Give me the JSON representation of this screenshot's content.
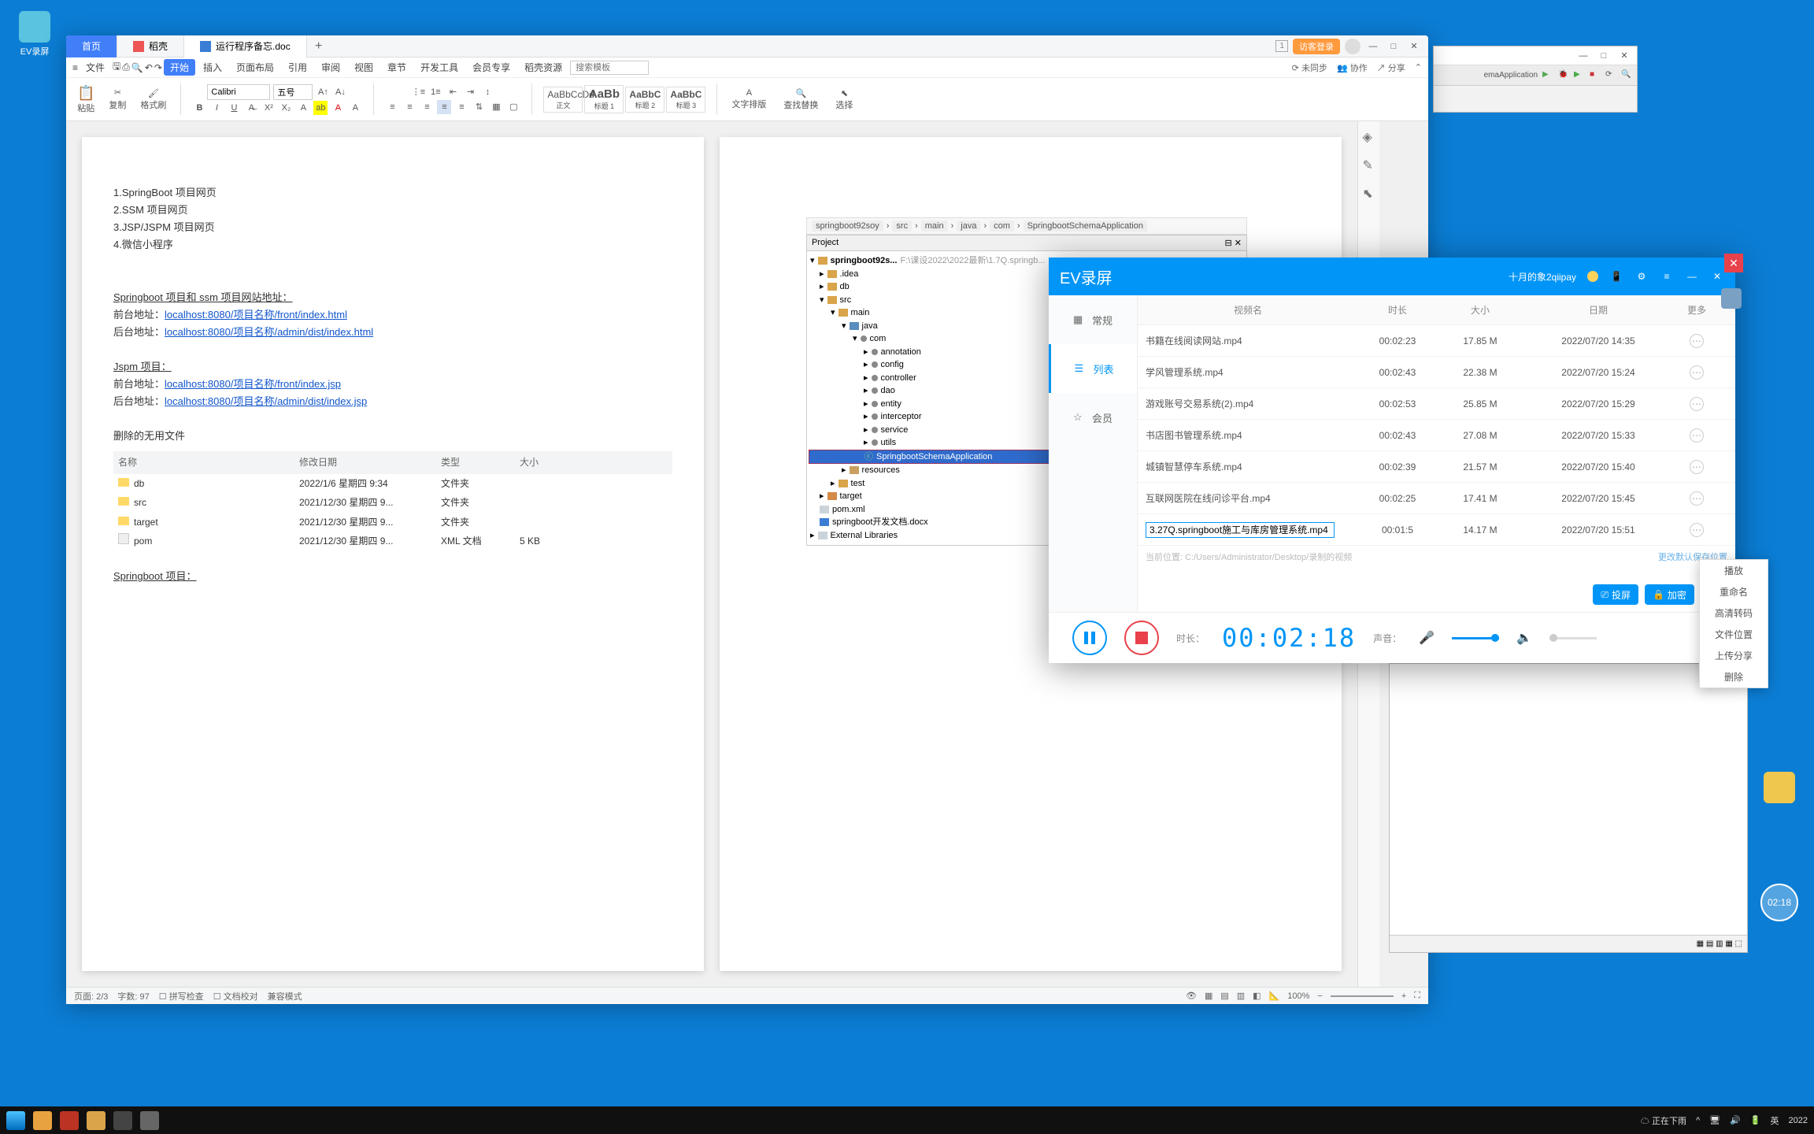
{
  "wps": {
    "tabs": {
      "home": "首页",
      "doc1": "稻壳",
      "doc2": "运行程序备忘.doc"
    },
    "visitor": "访客登录",
    "menubar": [
      "文件",
      "开始",
      "插入",
      "页面布局",
      "引用",
      "审阅",
      "视图",
      "章节",
      "开发工具",
      "会员专享",
      "稻壳资源"
    ],
    "menubar_search_placeholder": "搜索模板",
    "menubar_right": [
      "未同步",
      "协作",
      "分享"
    ],
    "ribbon": {
      "paste": "粘贴",
      "copy": "复制",
      "format_painter": "格式刷",
      "font_name": "Calibri",
      "font_size": "五号",
      "style_normal": "正文",
      "style_h1": "标题 1",
      "style_h2": "标题 2",
      "style_h3": "标题 3",
      "prev_normal": "AaBbCcDd",
      "prev_h": "AaBb",
      "prev_h2": "AaBbC",
      "prev_h3": "AaBbC",
      "text_tools": "文字排版",
      "find_replace": "查找替换",
      "select": "选择"
    },
    "doc": {
      "l1": "1.SpringBoot 项目网页",
      "l2": "2.SSM 项目网页",
      "l3": "3.JSP/JSPM 项目网页",
      "l4": "4.微信小程序",
      "sec2_title": "Springboot 项目和 ssm 项目网站地址：",
      "sec2_front_label": "前台地址：",
      "sec2_front_url": "localhost:8080/项目名称/front/index.html",
      "sec2_back_label": "后台地址：",
      "sec2_back_url": "localhost:8080/项目名称/admin/dist/index.html",
      "sec3_title": "Jspm 项目：",
      "sec3_front_url": "localhost:8080/项目名称/front/index.jsp",
      "sec3_back_url": "localhost:8080/项目名称/admin/dist/index.jsp",
      "sec4_title": "删除的无用文件",
      "table": {
        "h_name": "名称",
        "h_date": "修改日期",
        "h_type": "类型",
        "h_size": "大小",
        "rows": [
          {
            "name": "db",
            "date": "2022/1/6 星期四 9:34",
            "type": "文件夹",
            "size": ""
          },
          {
            "name": "src",
            "date": "2021/12/30 星期四 9...",
            "type": "文件夹",
            "size": ""
          },
          {
            "name": "target",
            "date": "2021/12/30 星期四 9...",
            "type": "文件夹",
            "size": ""
          },
          {
            "name": "pom",
            "date": "2021/12/30 星期四 9...",
            "type": "XML 文档",
            "size": "5 KB"
          }
        ]
      },
      "sec5_title": "Springboot 项目："
    },
    "ide_embed": {
      "crumbs": [
        "springboot92soy",
        "src",
        "main",
        "java",
        "com",
        "SpringbootSchemaApplication"
      ],
      "project_label": "Project",
      "root": "springboot92s...",
      "root_path": "F:\\课设2022\\2022最新\\1.7Q.springb...",
      "nodes": {
        "idea": ".idea",
        "db": "db",
        "src": "src",
        "main": "main",
        "java": "java",
        "com": "com",
        "annotation": "annotation",
        "config": "config",
        "controller": "controller",
        "dao": "dao",
        "entity": "entity",
        "interceptor": "interceptor",
        "service": "service",
        "utils": "utils",
        "app": "SpringbootSchemaApplication",
        "resources": "resources",
        "test": "test",
        "target": "target",
        "pom": "pom.xml",
        "devdoc": "springboot开发文档.docx",
        "extlib": "External Libraries"
      }
    },
    "statusbar": {
      "page": "页面: 2/3",
      "words": "字数: 97",
      "spell": "拼写检查",
      "proof": "文档校对",
      "compat": "兼容模式",
      "zoom": "100%"
    }
  },
  "ev": {
    "title": "EV录屏",
    "user": "十月的象2qiipay",
    "sidebar": {
      "general": "常规",
      "list": "列表",
      "member": "会员"
    },
    "columns": {
      "name": "视频名",
      "duration": "时长",
      "size": "大小",
      "date": "日期",
      "more": "更多"
    },
    "rows": [
      {
        "name": "书籍在线阅读网站.mp4",
        "duration": "00:02:23",
        "size": "17.85 M",
        "date": "2022/07/20 14:35"
      },
      {
        "name": "学风管理系统.mp4",
        "duration": "00:02:43",
        "size": "22.38 M",
        "date": "2022/07/20 15:24"
      },
      {
        "name": "游戏账号交易系统(2).mp4",
        "duration": "00:02:53",
        "size": "25.85 M",
        "date": "2022/07/20 15:29"
      },
      {
        "name": "书店图书管理系统.mp4",
        "duration": "00:02:43",
        "size": "27.08 M",
        "date": "2022/07/20 15:33"
      },
      {
        "name": "城镇智慧停车系统.mp4",
        "duration": "00:02:39",
        "size": "21.57 M",
        "date": "2022/07/20 15:40"
      },
      {
        "name": "互联网医院在线问诊平台.mp4",
        "duration": "00:02:25",
        "size": "17.41 M",
        "date": "2022/07/20 15:45"
      }
    ],
    "editing_row": {
      "value": "3.27Q.springboot施工与库房管理系统.mp4",
      "duration": "00:01:5",
      "size": "14.17 M",
      "date": "2022/07/20 15:51"
    },
    "path_label": "当前位置: C:/Users/Administrator/Desktop/录制的视频",
    "path_link": "更改默认保存位置",
    "bottom": {
      "duration_label": "时长：",
      "timer": "00:02:18",
      "sound_label": "声音："
    },
    "actions": {
      "record": "投屏",
      "encrypt": "加密",
      "cut": ""
    }
  },
  "ctx_menu": [
    "播放",
    "重命名",
    "高清转码",
    "文件位置",
    "上传分享",
    "删除"
  ],
  "ide_bg": {
    "app_tab": "emaApplication"
  },
  "time_badge": "02:18",
  "taskbar": {
    "weather": "正在下雨",
    "ime": "英",
    "time": "2022"
  }
}
